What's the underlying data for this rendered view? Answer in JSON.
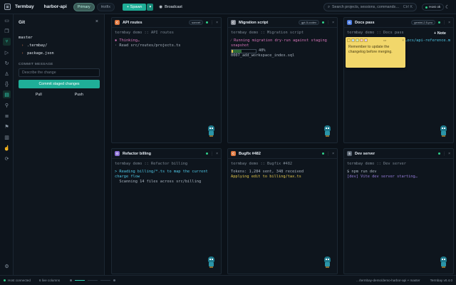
{
  "topbar": {
    "brand": "Termbay",
    "project": "harbor-api",
    "worktrees": [
      {
        "label": "Primary",
        "active": true
      },
      {
        "label": "Hotfix",
        "active": false
      }
    ],
    "spawn_label": "+ Spawn",
    "spawn_caret": "▾",
    "broadcast_label": "Broadcast",
    "search_placeholder": "Search projects, sessions, commands…",
    "search_shortcut": "Ctrl K",
    "host_status": "Host ok"
  },
  "rail": {
    "icons": [
      "folder-icon",
      "files-icon",
      "git-branch-icon",
      "play-icon",
      "refresh-icon",
      "users-icon",
      "braces-icon",
      "git-icon",
      "link-icon",
      "layers-icon",
      "flag-icon",
      "archive-icon",
      "hand-icon",
      "sync-icon",
      "settings-icon"
    ]
  },
  "git": {
    "title": "Git",
    "branch": "master",
    "files": [
      {
        "name": ".termbay/"
      },
      {
        "name": "package.json"
      }
    ],
    "commit_label": "COMMIT MESSAGE",
    "commit_placeholder": "Describe the change",
    "commit_button": "Commit staged changes",
    "pull": "Pull",
    "push": "Push"
  },
  "panes": [
    {
      "title": "API routes",
      "type": "C",
      "type_color": "#e0783f",
      "badge": "sonnet",
      "header_line": "termbay demo :: API routes",
      "lines": [
        {
          "text": "✱ Thinking…",
          "cls": "hl-pink"
        },
        {
          "text": "· Read src/routes/projects.ts",
          "cls": ""
        }
      ]
    },
    {
      "title": "Migration script",
      "type": "C",
      "type_color": "#8a8f99",
      "badge": "gpt-5-codex",
      "header_line": "termbay demo :: Migration script",
      "lines": [
        {
          "text": "⁄ Running migration dry-run against staging snapshot",
          "cls": "hl-pink"
        }
      ],
      "progress_percent": "40%",
      "progress_file": "0007_add_workspace_index.sql"
    },
    {
      "title": "Docs pass",
      "type": "G",
      "type_color": "#4b7be0",
      "badge": "gemini-2.5-pro",
      "header_line": "termbay demo :: Docs pass",
      "lines": [
        {
          "text": "…ocs/api-reference.m",
          "cls": "hl-cyan"
        }
      ]
    },
    {
      "title": "Refactor billing",
      "type": "O",
      "type_color": "#8b6fd6",
      "badge": "",
      "header_line": "termbay demo :: Refactor billing",
      "lines": [
        {
          "text": "> Reading billing/*.ts to map the current charge flow",
          "cls": "hl-cyan"
        },
        {
          "text": "  Scanning 14 files across src/billing",
          "cls": ""
        }
      ]
    },
    {
      "title": "Bugfix #482",
      "type": "C",
      "type_color": "#e0783f",
      "badge": "",
      "header_line": "termbay demo :: Bugfix #482",
      "lines": [
        {
          "text": "Tokens: 1,284 sent, 348 received",
          "cls": ""
        },
        {
          "text": "Applying edit to billing/tax.ts",
          "cls": "hl-yellow"
        }
      ]
    },
    {
      "title": "Dev server",
      "type": "S",
      "type_color": "#5a6673",
      "badge": "",
      "header_line": "termbay demo :: Dev server",
      "lines": [
        {
          "text": "$ npm run dev",
          "cls": ""
        },
        {
          "text": "[dev] Vite dev server starting…",
          "cls": "mixed"
        }
      ]
    }
  ],
  "note": {
    "add_label": "+ Note",
    "text": "Remember to update the changelog before merging."
  },
  "statusbar": {
    "host": "Host connected",
    "columns": "6 live columns",
    "path": "…/termbay-demo/demo-harbor-api",
    "branch": "master",
    "version": "Termbay v0.4.0"
  }
}
